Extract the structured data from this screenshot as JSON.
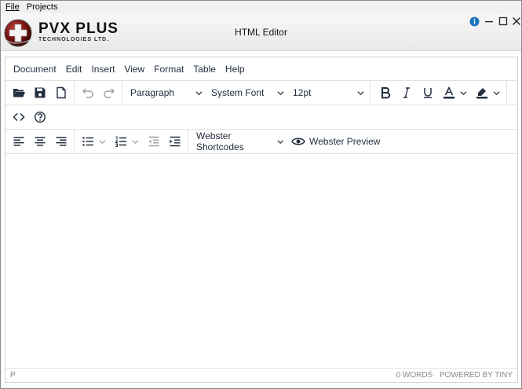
{
  "app_menu": {
    "file": "File",
    "projects": "Projects"
  },
  "brand": {
    "title": "PVX PLUS",
    "subtitle": "TECHNOLOGIES LTD."
  },
  "window": {
    "title": "HTML Editor"
  },
  "editor_menu": [
    "Document",
    "Edit",
    "Insert",
    "View",
    "Format",
    "Table",
    "Help"
  ],
  "toolbar": {
    "block_format": "Paragraph",
    "font_family": "System Font",
    "font_size": "12pt",
    "webster_shortcodes": "Webster Shortcodes",
    "webster_preview": "Webster Preview"
  },
  "status": {
    "path": "P",
    "word_count": "0 WORDS",
    "powered_by": "POWERED BY TINY"
  },
  "colors": {
    "accent": "#222f3e",
    "info": "#1e73be",
    "logo_red": "#8b1a1a"
  },
  "icons": [
    "open-folder-icon",
    "save-icon",
    "new-document-icon",
    "undo-icon",
    "redo-icon",
    "bold-icon",
    "italic-icon",
    "underline-icon",
    "text-color-icon",
    "highlight-icon",
    "source-code-icon",
    "help-icon",
    "align-left-icon",
    "align-center-icon",
    "align-right-icon",
    "bullet-list-icon",
    "numbered-list-icon",
    "outdent-icon",
    "indent-icon",
    "eye-icon"
  ]
}
